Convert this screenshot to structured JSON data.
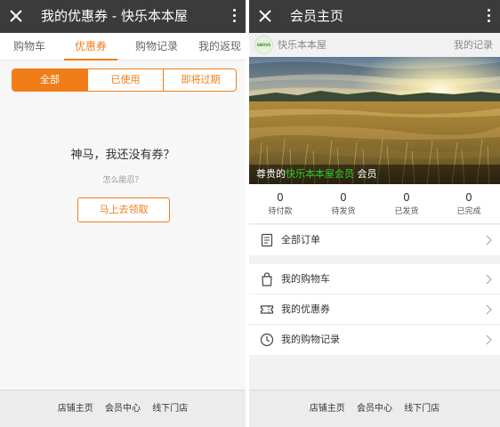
{
  "left": {
    "titlebar": {
      "title": "我的优惠券 - 快乐本本屋"
    },
    "tabs": [
      {
        "label": "购物车"
      },
      {
        "label": "优惠券"
      },
      {
        "label": "购物记录"
      },
      {
        "label": "我的返现"
      }
    ],
    "filter": {
      "all": "全部",
      "used": "已使用",
      "expiring": "即将过期"
    },
    "empty": {
      "title": "神马，我还没有券？",
      "subtitle": "怎么能忍？",
      "button": "马上去领取"
    },
    "footer": {
      "home": "店铺主页",
      "member": "会员中心",
      "offline": "线下门店"
    }
  },
  "right": {
    "titlebar": {
      "title": "会员主页"
    },
    "store": {
      "logo_text": "GBOVS",
      "name": "快乐本本屋",
      "records_link": "我的记录"
    },
    "banner": {
      "prefix": "尊贵的",
      "highlight": "快乐本本屋会员",
      "suffix": "会员"
    },
    "stats": [
      {
        "value": "0",
        "label": "待付款"
      },
      {
        "value": "0",
        "label": "待发货"
      },
      {
        "value": "0",
        "label": "已发货"
      },
      {
        "value": "0",
        "label": "已完成"
      }
    ],
    "orders": {
      "label": "全部订单"
    },
    "menu": [
      {
        "label": "我的购物车",
        "icon": "shopping-bag-icon"
      },
      {
        "label": "我的优惠券",
        "icon": "ticket-icon"
      },
      {
        "label": "我的购物记录",
        "icon": "clock-icon"
      }
    ],
    "footer": {
      "home": "店铺主页",
      "member": "会员中心",
      "offline": "线下门店"
    }
  },
  "colors": {
    "accent": "#f07d1a",
    "titlebar": "#3b3b3b",
    "highlight": "#2ecc2e"
  }
}
